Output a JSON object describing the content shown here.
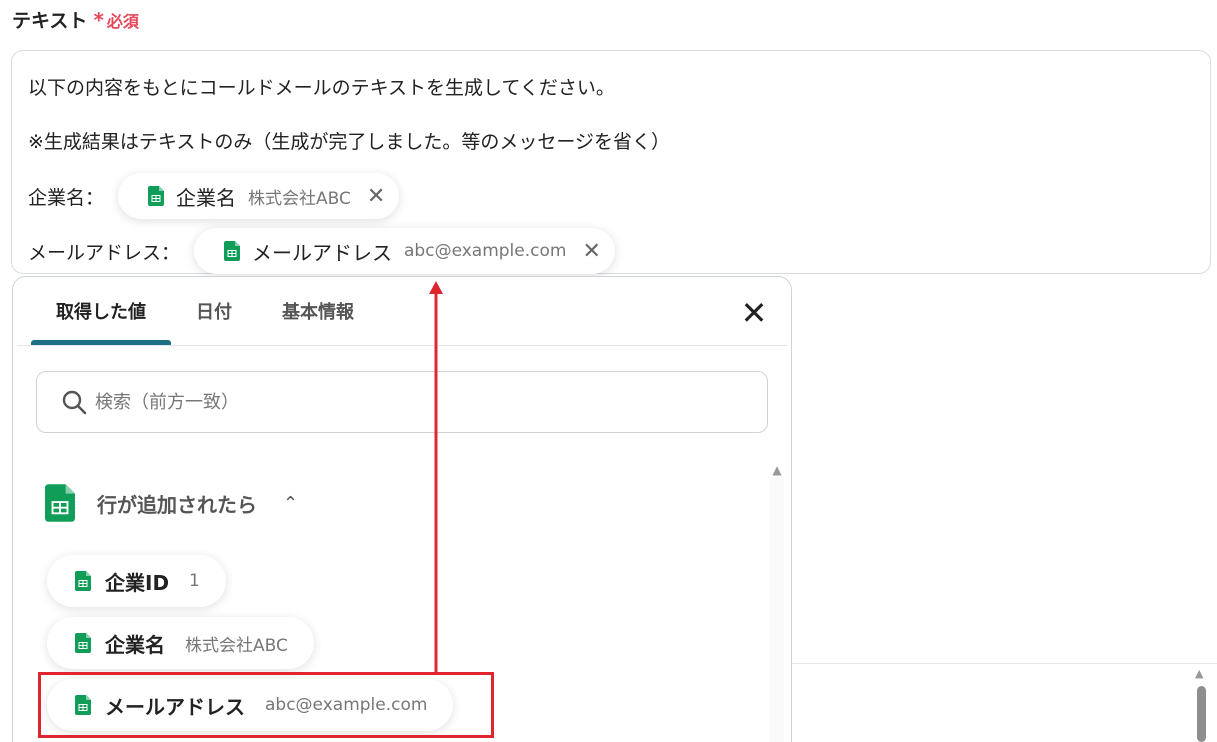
{
  "field": {
    "label": "テキスト",
    "required": "必須",
    "required_mark": "*"
  },
  "textarea": {
    "line1": "以下の内容をもとにコールドメールのテキストを生成してください。",
    "line2": "※生成結果はテキストのみ（生成が完了しました。等のメッセージを省く）",
    "company_prefix": "企業名：",
    "company_chip": {
      "label": "企業名",
      "value": "株式会社ABC",
      "remove": "✕"
    },
    "email_prefix": "メールアドレス：",
    "email_chip": {
      "label": "メールアドレス",
      "value": "abc@example.com",
      "remove": "✕"
    }
  },
  "panel": {
    "tabs": [
      {
        "label": "取得した値",
        "active": true
      },
      {
        "label": "日付",
        "active": false
      },
      {
        "label": "基本情報",
        "active": false
      }
    ],
    "close": "✕",
    "search_placeholder": "検索（前方一致）",
    "group": {
      "title": "行が追加されたら",
      "chevron": "⌃",
      "items": [
        {
          "label": "企業ID",
          "value": "1"
        },
        {
          "label": "企業名",
          "value": "株式会社ABC"
        },
        {
          "label": "メールアドレス",
          "value": "abc@example.com"
        }
      ]
    }
  },
  "icons": {
    "sheet": "spreadsheet-icon",
    "search": "search-icon",
    "close": "close-icon"
  },
  "colors": {
    "accent": "#1c6f85",
    "required": "#e5475a",
    "sheets_green": "#0f9d58",
    "annotation_red": "#e1252f"
  }
}
